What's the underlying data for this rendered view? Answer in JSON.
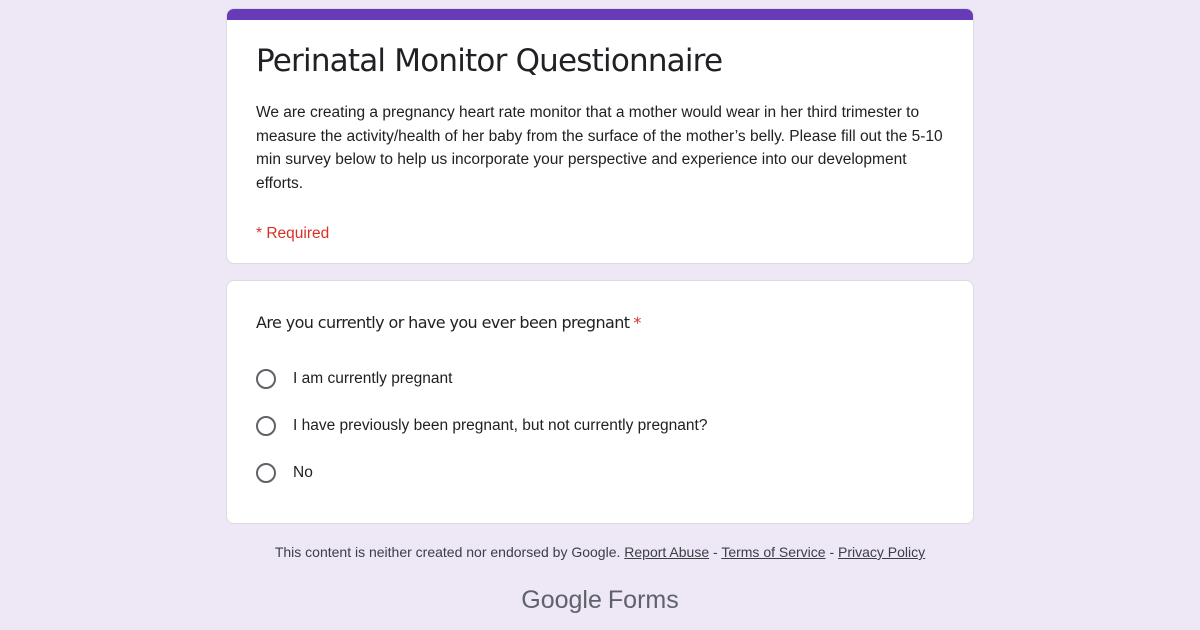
{
  "colors": {
    "page_background": "#ede7f6",
    "accent": "#673ab7",
    "required": "#d93025"
  },
  "form": {
    "title": "Perinatal Monitor Questionnaire",
    "description": "We are creating a  pregnancy heart rate monitor that a mother would wear in her third trimester to measure the activity/health of her baby from the surface of the mother’s belly.  Please fill out the 5-10 min survey below to help us incorporate your perspective and experience into our development efforts.",
    "required_note": "* Required"
  },
  "question": {
    "title": "Are you currently or have you ever been pregnant",
    "required_marker": "*",
    "options": [
      {
        "label": "I am currently pregnant",
        "selected": false,
        "icon": "radio-unchecked-icon"
      },
      {
        "label": "I have previously been pregnant, but not currently pregnant?",
        "selected": false,
        "icon": "radio-unchecked-icon"
      },
      {
        "label": "No",
        "selected": false,
        "icon": "radio-unchecked-icon"
      }
    ]
  },
  "footer": {
    "disclaimer": "This content is neither created nor endorsed by Google.",
    "report_abuse": "Report Abuse",
    "separator": "-",
    "terms": "Terms of Service",
    "privacy": "Privacy Policy"
  },
  "brand": {
    "google": "Google",
    "forms": "Forms"
  }
}
